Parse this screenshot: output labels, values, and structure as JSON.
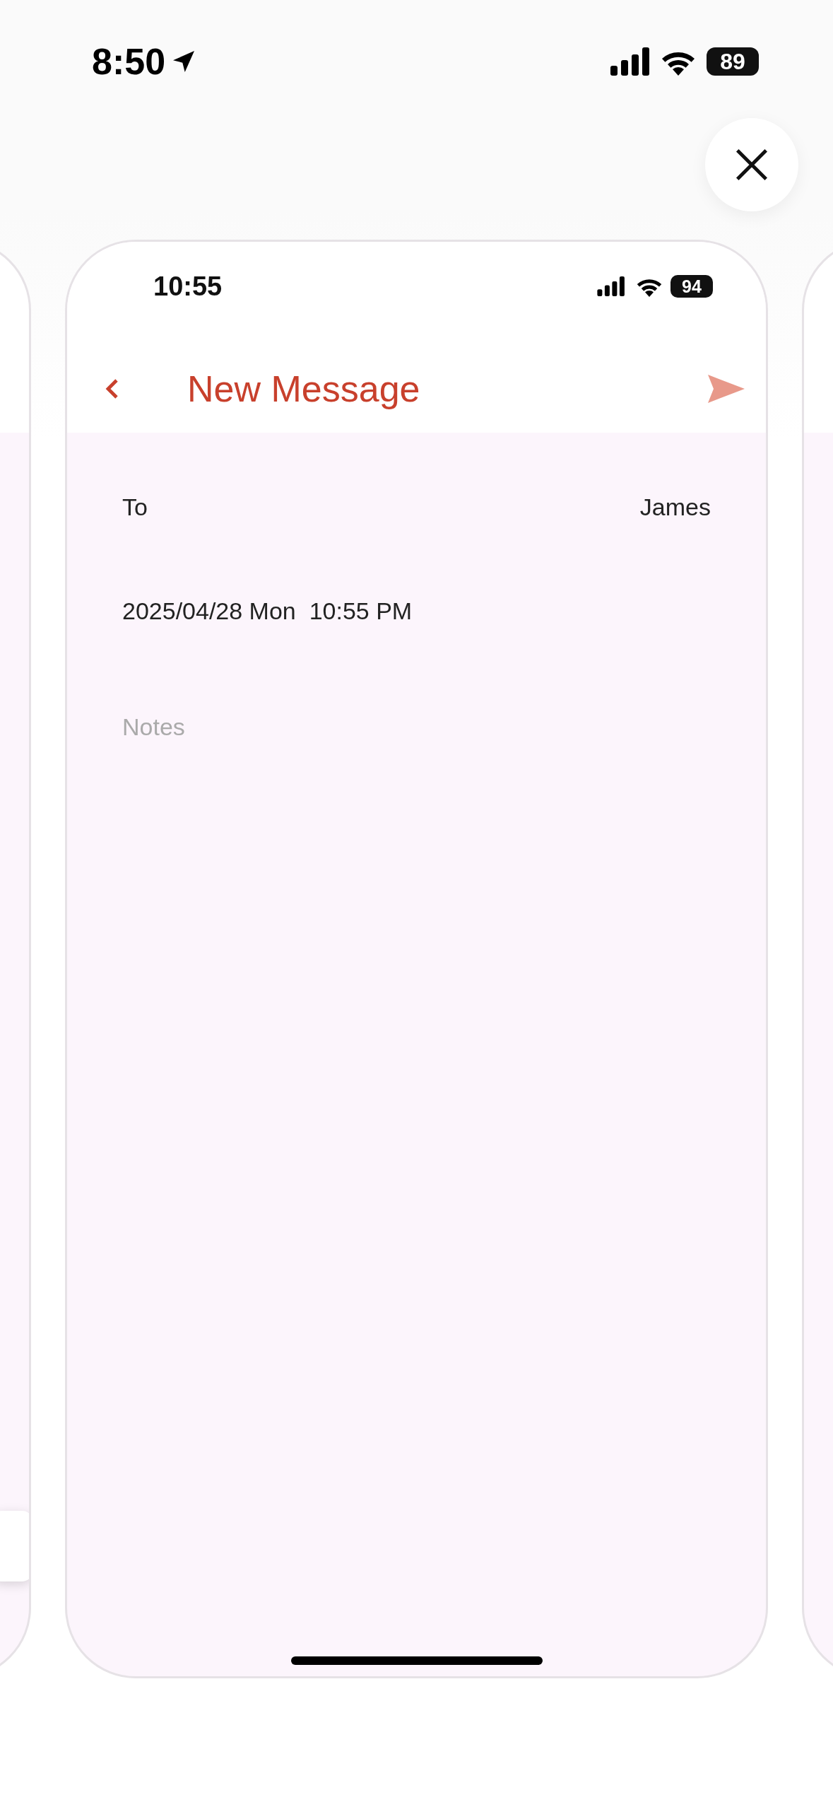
{
  "status_bar": {
    "time": "8:50",
    "battery": "89"
  },
  "preview": {
    "status_bar": {
      "time": "10:55",
      "battery": "94"
    },
    "header": {
      "title": "New Message"
    },
    "fields": [
      {
        "kind": "pair",
        "label": "To",
        "value": "James"
      },
      {
        "kind": "text",
        "value": "2025/04/28 Mon  10:55 PM"
      },
      {
        "kind": "input",
        "placeholder": "Notes"
      }
    ]
  }
}
